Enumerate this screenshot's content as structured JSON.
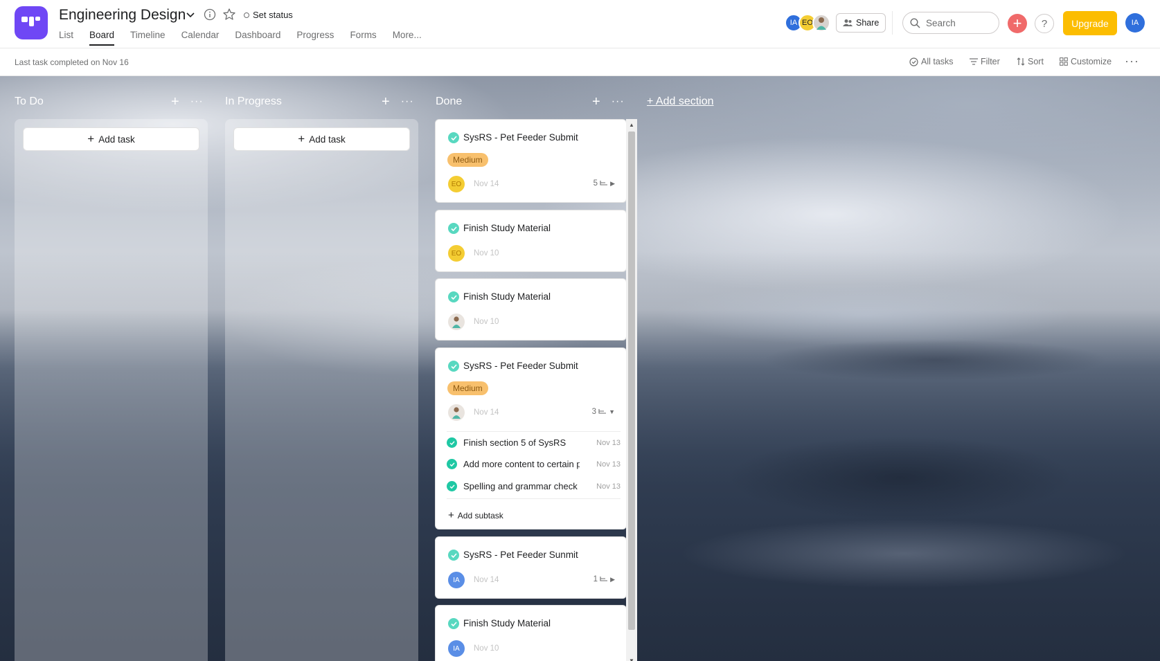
{
  "header": {
    "project_title": "Engineering Design",
    "set_status": "Set status",
    "tabs": [
      "List",
      "Board",
      "Timeline",
      "Calendar",
      "Dashboard",
      "Progress",
      "Forms",
      "More..."
    ],
    "active_tab": "Board",
    "members": [
      {
        "initials": "IA",
        "color": "#2f6fdc"
      },
      {
        "initials": "EO",
        "color": "#f4cd33"
      },
      {
        "initials": "",
        "kind": "photo"
      }
    ],
    "share_label": "Share",
    "search_placeholder": "Search",
    "upgrade_label": "Upgrade",
    "user_initials": "IA"
  },
  "toolbar": {
    "last_task": "Last task completed on Nov 16",
    "all_tasks": "All tasks",
    "filter": "Filter",
    "sort": "Sort",
    "customize": "Customize"
  },
  "board": {
    "columns": [
      {
        "name": "To Do",
        "add_task": "Add task"
      },
      {
        "name": "In Progress",
        "add_task": "Add task"
      },
      {
        "name": "Done"
      }
    ],
    "add_section": "+ Add section",
    "done_cards": [
      {
        "title": "SysRS - Pet Feeder Submit",
        "tag": "Medium",
        "assignee": "EO",
        "date": "Nov 14",
        "subtasks": "5"
      },
      {
        "title": "Finish Study Material",
        "assignee": "EO",
        "date": "Nov 10"
      },
      {
        "title": "Finish Study Material",
        "assignee": "photo",
        "date": "Nov 10"
      },
      {
        "title": "SysRS - Pet Feeder Submit",
        "tag": "Medium",
        "assignee": "photo",
        "date": "Nov 14",
        "subtasks": "3",
        "subtask_list": [
          {
            "title": "Finish section 5 of SysRS",
            "date": "Nov 13"
          },
          {
            "title": "Add more content to certain p",
            "date": "Nov 13"
          },
          {
            "title": "Spelling and grammar check",
            "date": "Nov 13"
          }
        ],
        "add_subtask": "Add subtask"
      },
      {
        "title": "SysRS - Pet Feeder Sunmit",
        "assignee": "IA",
        "date": "Nov 14",
        "subtasks": "1"
      },
      {
        "title": "Finish Study Material",
        "assignee": "IA",
        "date": "Nov 10"
      }
    ]
  },
  "colors": {
    "accent": "#6f47f5",
    "upgrade": "#fcbd01",
    "add": "#f06a6a",
    "tag_medium": "#f8c06d",
    "check": "#30d4b4"
  }
}
